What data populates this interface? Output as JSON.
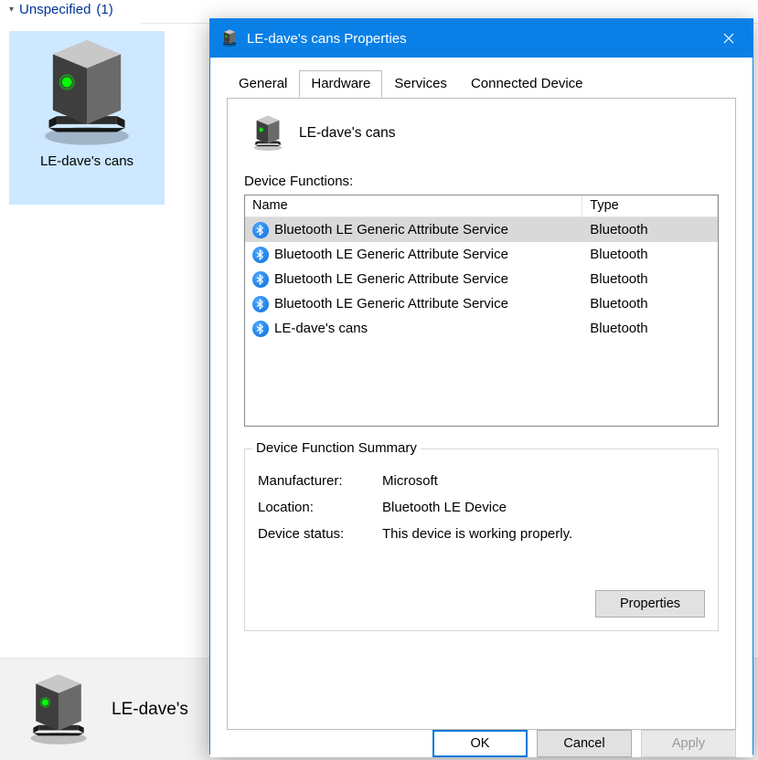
{
  "background": {
    "group_name": "Unspecified",
    "group_count": "(1)",
    "device_label": "LE-dave's cans",
    "bottom_device_label": "LE-dave's"
  },
  "dialog": {
    "title": "LE-dave's cans Properties",
    "tabs": {
      "general": "General",
      "hardware": "Hardware",
      "services": "Services",
      "connected": "Connected Device"
    },
    "device_name": "LE-dave's cans",
    "functions_label": "Device Functions:",
    "cols": {
      "name": "Name",
      "type": "Type"
    },
    "rows": [
      {
        "name": "Bluetooth LE Generic Attribute Service",
        "type": "Bluetooth",
        "selected": true
      },
      {
        "name": "Bluetooth LE Generic Attribute Service",
        "type": "Bluetooth",
        "selected": false
      },
      {
        "name": "Bluetooth LE Generic Attribute Service",
        "type": "Bluetooth",
        "selected": false
      },
      {
        "name": "Bluetooth LE Generic Attribute Service",
        "type": "Bluetooth",
        "selected": false
      },
      {
        "name": "LE-dave's cans",
        "type": "Bluetooth",
        "selected": false
      }
    ],
    "summary": {
      "title": "Device Function Summary",
      "manufacturer_k": "Manufacturer:",
      "manufacturer_v": "Microsoft",
      "location_k": "Location:",
      "location_v": "Bluetooth LE Device",
      "status_k": "Device status:",
      "status_v": "This device is working properly.",
      "properties_btn": "Properties"
    },
    "buttons": {
      "ok": "OK",
      "cancel": "Cancel",
      "apply": "Apply"
    }
  }
}
